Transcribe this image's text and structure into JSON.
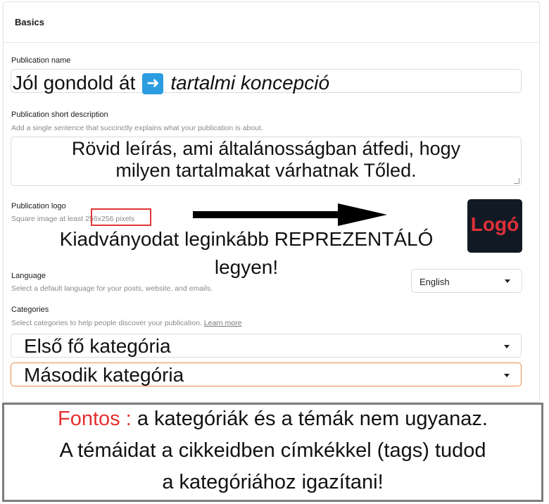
{
  "section": {
    "title": "Basics"
  },
  "publication_name": {
    "label": "Publication name",
    "overlay_text": "Jól gondold át",
    "arrow_icon": "right-arrow-emoji",
    "overlay_italic": "tartalmi koncepció"
  },
  "short_description": {
    "label": "Publication short description",
    "help": "Add a single sentence that succinctly explains what your publication is about.",
    "overlay_line1": "Rövid leírás, ami általánosságban átfedi, hogy",
    "overlay_line2": "milyen tartalmakat várhatnak Tőled."
  },
  "logo": {
    "label": "Publication logo",
    "help_prefix": "Square image at least",
    "help_size": "256x256 pixels",
    "tile_text": "Logó",
    "overlay_line1": "Kiadványodat leginkább REPREZENTÁLÓ",
    "overlay_line2": "legyen!"
  },
  "language": {
    "label": "Language",
    "help": "Select a default language for your posts, website, and emails.",
    "selected": "English"
  },
  "categories": {
    "label": "Categories",
    "help": "Select categories to help people discover your publication.",
    "learn_more": "Learn more",
    "first": "Első fő kategória",
    "second": "Második kategória"
  },
  "note": {
    "prefix": "Fontos :",
    "line1": " a kategóriák és a témák nem ugyanaz.",
    "line2": "A témáidat a cikkeidben címkékkel (tags) tudod",
    "line3": "a kategóriához igazítani!"
  },
  "colors": {
    "accent_red": "#e53030",
    "arrow_blue": "#2b9de0",
    "focus_orange": "#e88d4c",
    "logo_bg": "#111a24"
  }
}
